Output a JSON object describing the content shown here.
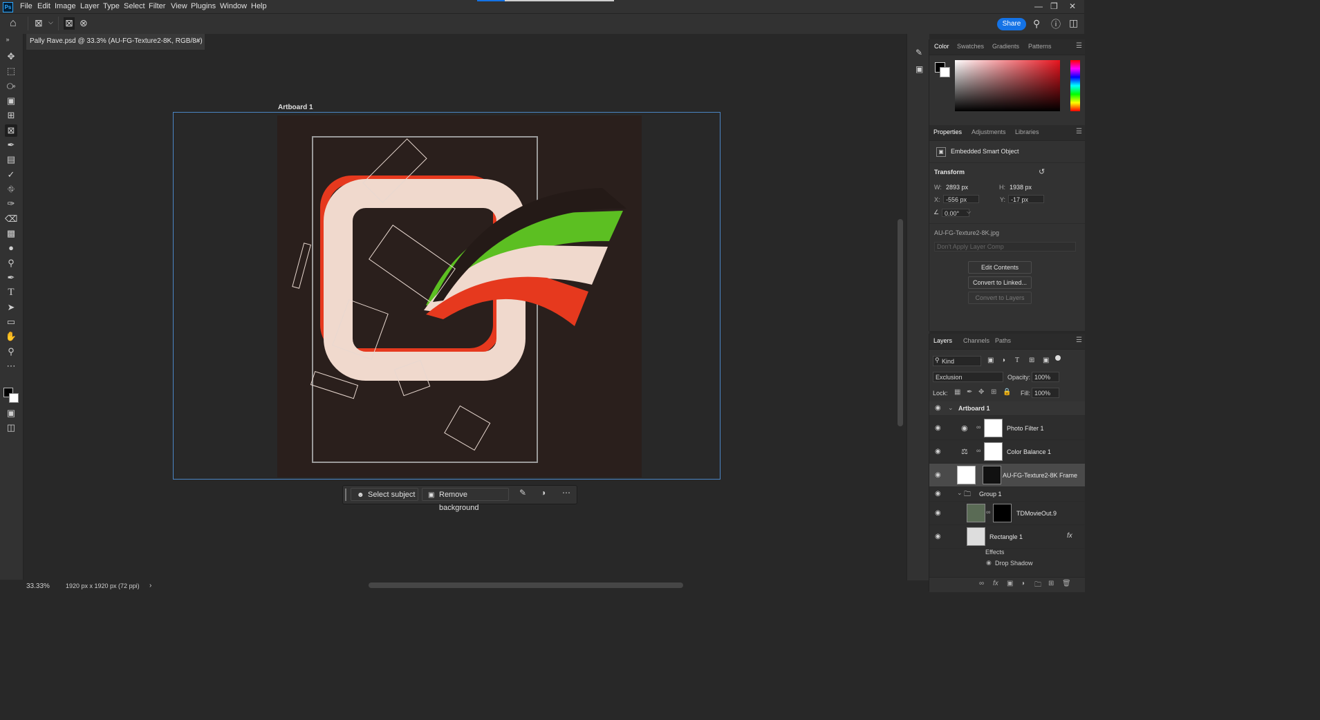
{
  "app": {
    "logo": "Ps",
    "menus": [
      "File",
      "Edit",
      "Image",
      "Layer",
      "Type",
      "Select",
      "Filter",
      "View",
      "Plugins",
      "Window",
      "Help"
    ]
  },
  "options": {
    "share_label": "Share"
  },
  "document": {
    "tab_title": "Pally Rave.psd @ 33.3% (AU-FG-Texture2-8K, RGB/8#) *",
    "artboard_label": "Artboard 1",
    "zoom": "33.33%",
    "doc_size": "1920 px x 1920 px (72 ppi)"
  },
  "context_bar": {
    "select_subject": "Select subject",
    "remove_background": "Remove background"
  },
  "color_panel": {
    "tabs": [
      "Color",
      "Swatches",
      "Gradients",
      "Patterns"
    ],
    "active_tab": "Color",
    "foreground": "#000000",
    "background": "#ffffff"
  },
  "properties_panel": {
    "tabs": [
      "Properties",
      "Adjustments",
      "Libraries"
    ],
    "type_label": "Embedded Smart Object",
    "transform_label": "Transform",
    "w_label": "W:",
    "w": "2893 px",
    "h_label": "H:",
    "h": "1938 px",
    "x_label": "X:",
    "x": "-556 px",
    "y_label": "Y:",
    "y": "-17 px",
    "angle": "0.00°",
    "filename": "AU-FG-Texture2-8K.jpg",
    "layer_comp": "Don't Apply Layer Comp",
    "edit_contents": "Edit Contents",
    "convert_linked": "Convert to Linked...",
    "convert_layers": "Convert to Layers"
  },
  "layers_panel": {
    "tabs": [
      "Layers",
      "Channels",
      "Paths"
    ],
    "filter": "Kind",
    "blend_mode": "Exclusion",
    "opacity_label": "Opacity:",
    "opacity": "100%",
    "lock_label": "Lock:",
    "fill_label": "Fill:",
    "fill": "100%",
    "layers": [
      {
        "name": "Artboard 1"
      },
      {
        "name": "Photo Filter 1"
      },
      {
        "name": "Color Balance 1"
      },
      {
        "name": "AU-FG-Texture2-8K Frame"
      },
      {
        "name": "Group 1"
      },
      {
        "name": "TDMovieOut.9"
      },
      {
        "name": "Rectangle 1"
      }
    ],
    "effects_label": "Effects",
    "drop_shadow_label": "Drop Shadow",
    "fx_label": "fx"
  },
  "colors": {
    "accent": "#1473e6",
    "artboard_outline": "#4b86c6",
    "art_bg": "#2a1f1c",
    "red": "#e6391e",
    "green": "#5cbf22",
    "cream": "#f0d9cd"
  }
}
